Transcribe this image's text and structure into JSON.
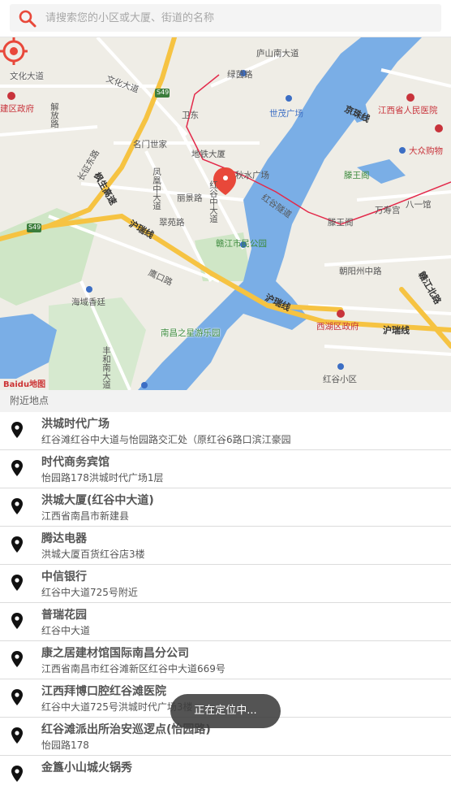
{
  "search": {
    "placeholder": "请搜索您的小区或大厦、街道的名称"
  },
  "map": {
    "labels": {
      "lushan_south": "庐山南大道",
      "lvyin": "绿茵路",
      "wenhua": "文化大道",
      "wenhua2": "文化大道",
      "district_gov": "建区政府",
      "jiefang": "解放路",
      "s49": "S49",
      "s49b": "S49",
      "weidong": "卫东",
      "mingmen": "名门世家",
      "subway": "地铁大厦",
      "shimao": "世茂广场",
      "jingzhu": "京珠线",
      "jx_hospital": "江西省人民医院",
      "dazhong": "大众购物",
      "changzheng": "长征东路",
      "fenghuang": "凤凰中大道",
      "honggu": "红谷中大道",
      "lijing": "丽景路",
      "qiushui": "秋水广场",
      "tengwang": "滕王阁",
      "tengwang2": "滕王阁",
      "wanshougong": "万寿宫",
      "bayi": "八一馆",
      "feng": "枫生高速",
      "hurui": "沪瑞线",
      "cuiyuan": "翠苑路",
      "honggu_tunnel": "红谷隧道",
      "ganjiang_park": "赣江市民公园",
      "chaoyang": "朝阳州中路",
      "ganjiang_n": "赣江北路",
      "hurui2": "沪瑞线",
      "hurui3": "沪瑞线",
      "yingkou": "鹰口路",
      "haiyu": "海域香廷",
      "xihu_gov": "西湖区政府",
      "nanchang_star": "南昌之星游乐园",
      "fenghe": "丰和南大道",
      "honggu_xiaoqu": "红谷小区",
      "baidu": "Baidu地图"
    }
  },
  "nearby": {
    "header": "附近地点",
    "items": [
      {
        "title": "洪城时代广场",
        "address": "红谷滩红谷中大道与怡园路交汇处（原红谷6路口滨江豪园"
      },
      {
        "title": "时代商务宾馆",
        "address": "怡园路178洪城时代广场1层"
      },
      {
        "title": "洪城大厦(红谷中大道)",
        "address": "江西省南昌市新建县"
      },
      {
        "title": "腾达电器",
        "address": "洪城大厦百货红谷店3楼"
      },
      {
        "title": "中信银行",
        "address": "红谷中大道725号附近"
      },
      {
        "title": "普瑞花园",
        "address": "红谷中大道"
      },
      {
        "title": "康之居建材馆国际南昌分公司",
        "address": "江西省南昌市红谷滩新区红谷中大道669号"
      },
      {
        "title": "江西拜博口腔红谷滩医院",
        "address": "红谷中大道725号洪城时代广场3楼"
      },
      {
        "title": "红谷滩派出所治安巡逻点(怡园路)",
        "address": "怡园路178"
      },
      {
        "title": "金簋小山城火锅秀",
        "address": ""
      }
    ]
  },
  "toast": {
    "text": "正在定位中..."
  },
  "colors": {
    "accent": "#e8483a",
    "river": "#7aaee6",
    "highway": "#f6c342",
    "rail": "#e3294a"
  }
}
